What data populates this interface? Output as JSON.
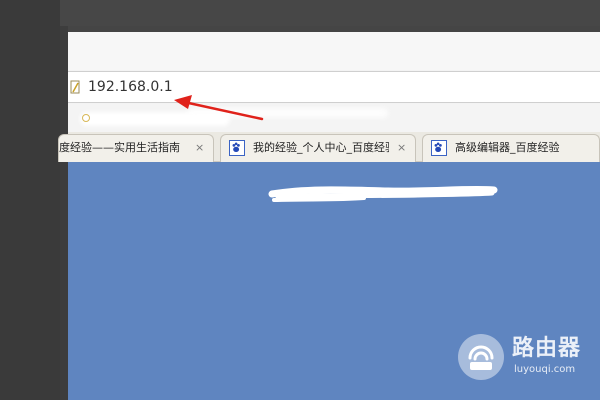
{
  "address_bar": {
    "url": "192.168.0.1"
  },
  "tabs": [
    {
      "label": "度经验——实用生活指南",
      "close": "×",
      "icon": "partial-favicon"
    },
    {
      "label": "我的经验_个人中心_百度经验",
      "close": "×",
      "icon": "baidu-paw-icon"
    },
    {
      "label": "高级编辑器_百度经验",
      "icon": "baidu-paw-icon"
    }
  ],
  "annotation": {
    "color": "#e0221b",
    "icon": "red-arrow-icon"
  },
  "watermark": {
    "title": "路由器",
    "subtitle": "luyouqi.com"
  },
  "colors": {
    "content_background": "#5f85c0",
    "tab_bar": "#ebe9e2",
    "outer_background": "#454545"
  }
}
